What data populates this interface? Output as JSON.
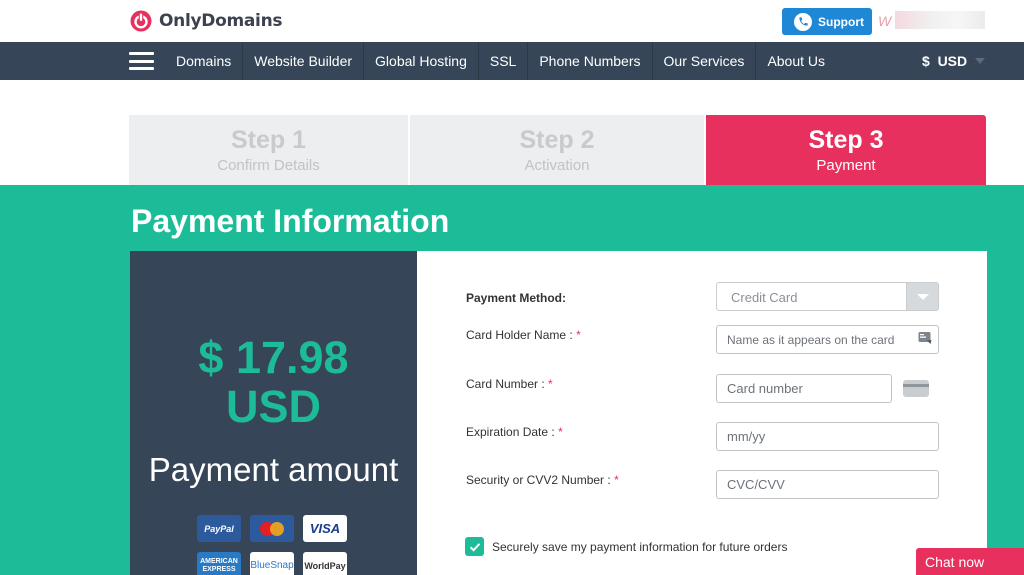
{
  "brand": {
    "name": "OnlyDomains",
    "accent": "#e8305e"
  },
  "header": {
    "support_label": "Support",
    "user_partial": "W"
  },
  "nav": {
    "items": [
      "Domains",
      "Website Builder",
      "Global Hosting",
      "SSL",
      "Phone Numbers",
      "Our Services",
      "About Us"
    ],
    "currency": "$  USD"
  },
  "steps": [
    {
      "title": "Step 1",
      "subtitle": "Confirm Details",
      "state": "inactive"
    },
    {
      "title": "Step 2",
      "subtitle": "Activation",
      "state": "inactive"
    },
    {
      "title": "Step 3",
      "subtitle": "Payment",
      "state": "active"
    }
  ],
  "page": {
    "title": "Payment Information"
  },
  "amount": {
    "line1": "$ 17.98",
    "line2": "USD",
    "label": "Payment amount"
  },
  "card_logos": {
    "paypal": "PayPal",
    "visa": "VISA",
    "amex_line1": "AMERICAN",
    "amex_line2": "EXPRESS",
    "bluesnap": "BlueSnap",
    "worldpay": "WorldPay"
  },
  "form": {
    "method_label": "Payment Method:",
    "method_value": "Credit Card",
    "holder_label": "Card Holder Name :",
    "holder_placeholder": "Name as it appears on the card",
    "number_label": "Card Number :",
    "number_placeholder": "Card number",
    "expiry_label": "Expiration Date :",
    "expiry_placeholder": "mm/yy",
    "cvv_label": "Security or CVV2 Number :",
    "cvv_placeholder": "CVC/CVV",
    "required_mark": "*",
    "save_label": "Securely save my payment information for future orders",
    "save_checked": true
  },
  "chat": {
    "label": "Chat now"
  },
  "colors": {
    "green": "#1dbc98",
    "navy": "#364658",
    "pink": "#e8305e",
    "support_blue": "#1e88d6"
  }
}
